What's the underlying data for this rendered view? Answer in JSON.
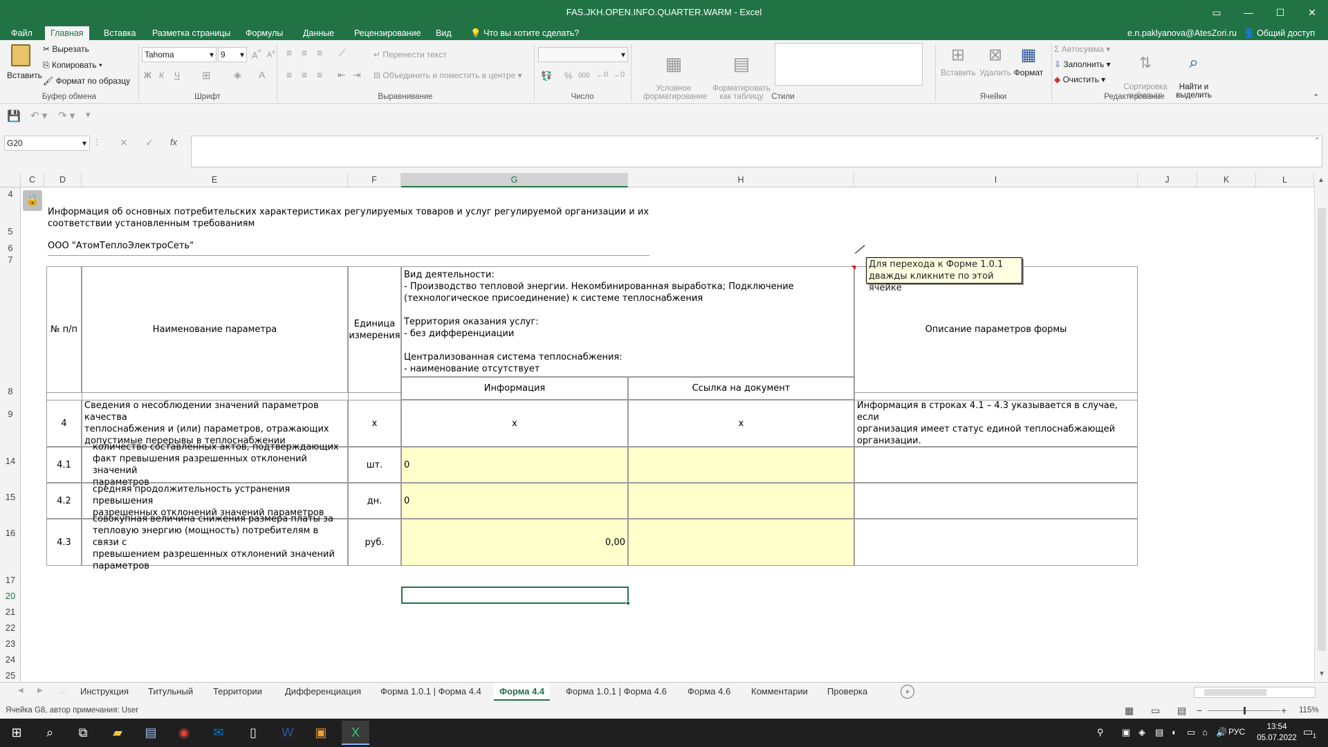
{
  "window": {
    "title": "FAS.JKH.OPEN.INFO.QUARTER.WARM - Excel"
  },
  "ribbon_tabs": [
    "Файл",
    "Главная",
    "Вставка",
    "Разметка страницы",
    "Формулы",
    "Данные",
    "Рецензирование",
    "Вид"
  ],
  "tell_me": "Что вы хотите сделать?",
  "user": "e.n.paklyanova@AtesZori.ru",
  "share": "Общий доступ",
  "clipboard": {
    "paste": "Вставить",
    "cut": "Вырезать",
    "copy": "Копировать",
    "format_painter": "Формат по образцу",
    "group": "Буфер обмена"
  },
  "font": {
    "name": "Tahoma",
    "size": "9",
    "group": "Шрифт",
    "bold": "Ж",
    "italic": "К",
    "underline": "Ч"
  },
  "alignment": {
    "wrap": "Перенести текст",
    "merge": "Объединить и поместить в центре",
    "group": "Выравнивание"
  },
  "number": {
    "group": "Число",
    "percent": "%",
    "thousands": "000"
  },
  "styles": {
    "conditional": "Условное\nформатирование",
    "as_table": "Форматировать\nкак таблицу",
    "group": "Стили"
  },
  "cells": {
    "insert": "Вставить",
    "delete": "Удалить",
    "format": "Формат",
    "group": "Ячейки"
  },
  "editing": {
    "autosum": "Автосумма",
    "fill": "Заполнить",
    "clear": "Очистить",
    "sort": "Сортировка\nи фильтр",
    "find": "Найти и\nвыделить",
    "group": "Редактирование"
  },
  "namebox": "G20",
  "fx": "fx",
  "columns": [
    "C",
    "D",
    "E",
    "F",
    "G",
    "H",
    "I",
    "J",
    "K",
    "L"
  ],
  "rows": [
    "4",
    "5",
    "6",
    "7",
    "8",
    "9",
    "14",
    "15",
    "16",
    "17",
    "20",
    "21",
    "22",
    "23",
    "24",
    "25"
  ],
  "sheet": {
    "heading": "Информация об основных потребительских характеристиках регулируемых товаров и услуг регулируемой организации и их\nсоответствии установленным требованиям",
    "org": "ООО \"АтомТеплоЭлектроСеть\"",
    "col_num": "№ п/п",
    "col_name": "Наименование параметра",
    "col_unit": "Единица\nизмерения",
    "activity_block": "Вид деятельности:\n  - Производство тепловой энергии. Некомбинированная выработка; Подключение\n(технологическое присоединение) к системе теплоснабжения\n\nТерритория оказания услуг:\n  - без дифференциации\n\nЦентрализованная система теплоснабжения:\n  - наименование отсутствует",
    "col_desc": "Описание параметров формы",
    "col_info": "Информация",
    "col_link": "Ссылка на документ",
    "rows": [
      {
        "num": "4",
        "name": "Сведения о несоблюдении значений параметров качества\nтеплоснабжения и (или) параметров, отражающих\nдопустимые перерывы в теплоснабжении",
        "unit": "x",
        "info": "x",
        "link": "x",
        "desc": "Информация в строках 4.1 – 4.3 указывается в случае, если\nорганизация имеет статус единой теплоснабжающей\nорганизации."
      },
      {
        "num": "4.1",
        "name": "количество составленных актов, подтверждающих\nфакт превышения разрешенных отклонений значений\nпараметров",
        "unit": "шт.",
        "info": "0",
        "link": "",
        "desc": ""
      },
      {
        "num": "4.2",
        "name": "средняя продолжительность устранения превышения\nразрешенных отклонений значений параметров",
        "unit": "дн.",
        "info": "0",
        "link": "",
        "desc": ""
      },
      {
        "num": "4.3",
        "name": "совокупная величина снижения размера платы за\nтепловую энергию (мощность) потребителям в связи с\nпревышением разрешенных отклонений значений\nпараметров",
        "unit": "руб.",
        "info": "0,00",
        "link": "",
        "desc": ""
      }
    ],
    "comment": "Для перехода к Форме 1.0.1\nдважды кликните по этой ячейке"
  },
  "sheet_tabs": [
    "Инструкция",
    "Титульный",
    "Территории",
    "Дифференциация",
    "Форма 1.0.1 | Форма 4.4",
    "Форма 4.4",
    "Форма 1.0.1 | Форма 4.6",
    "Форма 4.6",
    "Комментарии",
    "Проверка"
  ],
  "active_sheet": "Форма 4.4",
  "status": "Ячейка G8, автор примечания: User",
  "zoom": "115%",
  "taskbar": {
    "lang": "РУС",
    "time": "13:54",
    "date": "05.07.2022",
    "notif": "1"
  },
  "colors": {
    "excel_green": "#217346",
    "input_yellow": "#ffffcc"
  }
}
